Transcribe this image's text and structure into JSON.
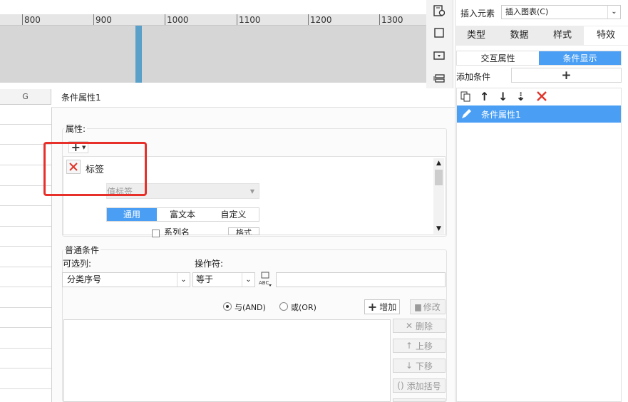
{
  "ruler": {
    "ticks": [
      "800",
      "900",
      "1000",
      "1100",
      "1200",
      "1300"
    ]
  },
  "sheet": {
    "column": "G"
  },
  "dialog": {
    "title": "条件属性1",
    "attr_group": "属性:",
    "add_symbol": "+",
    "label_item": "标签",
    "value_label_select": "值标签",
    "subtabs": [
      "通用",
      "富文本",
      "自定义"
    ],
    "series_checkbox": "系列名",
    "format_button": "格式",
    "common_group": "普通条件",
    "column_label": "可选列:",
    "operator_label": "操作符:",
    "column_value": "分类序号",
    "operator_value": "等于",
    "and_label": "与(AND)",
    "or_label": "或(OR)",
    "add_button": "增加",
    "modify_button": "修改",
    "delete_button": "删除",
    "up_button": "上移",
    "down_button": "下移",
    "bracket_button": "添加括号"
  },
  "panel": {
    "insert_label": "插入元素",
    "insert_select": "插入图表(C)",
    "tabs": [
      "类型",
      "数据",
      "样式",
      "特效"
    ],
    "subtabs": [
      "交互属性",
      "条件显示"
    ],
    "add_condition": "添加条件",
    "list_item": "条件属性1"
  }
}
